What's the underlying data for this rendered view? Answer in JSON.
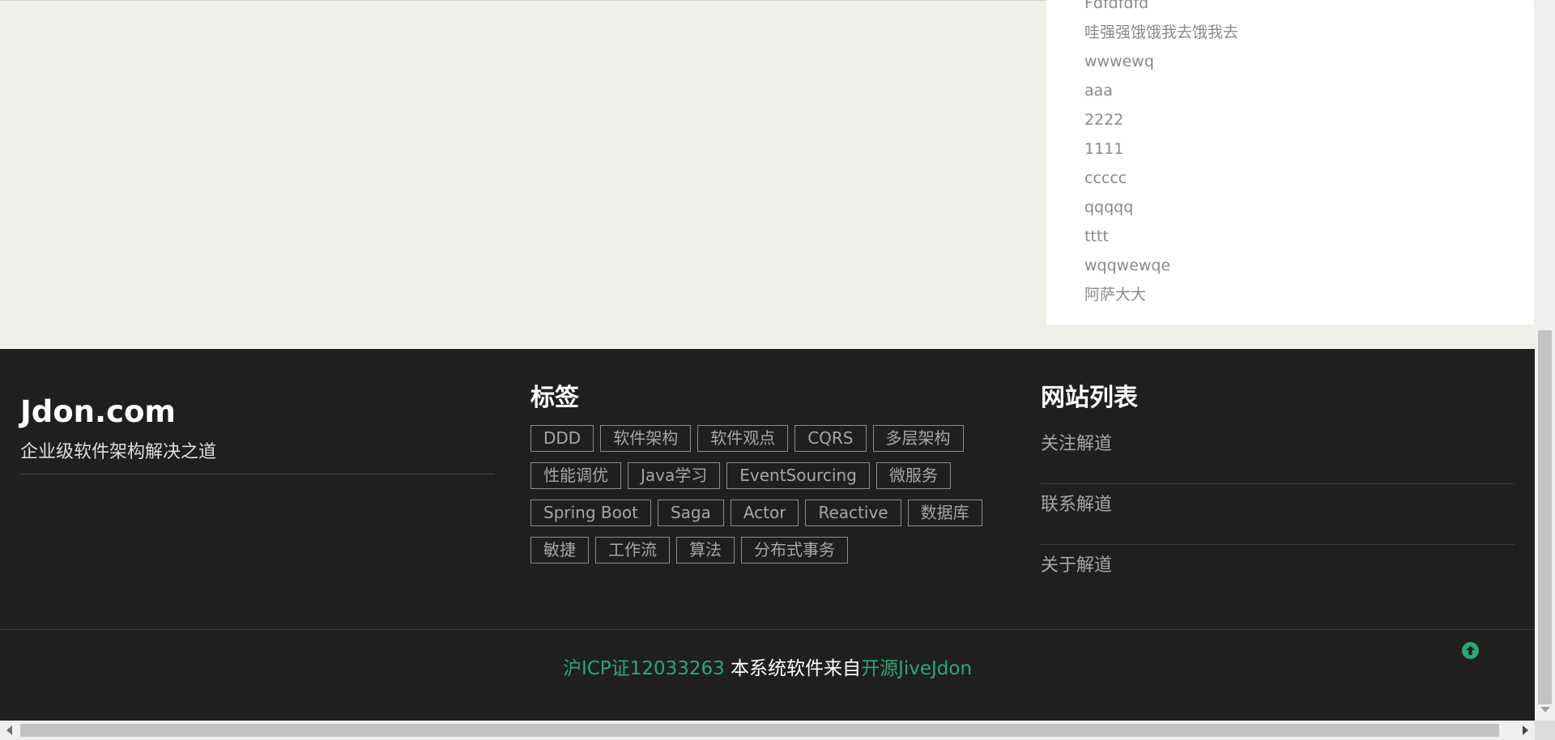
{
  "sidebar": {
    "items": [
      "Fdfdfdfd",
      "哇强强饿饿我去饿我去",
      "wwwewq",
      "aaa",
      "2222",
      "1111",
      "ccccc",
      "qqqqq",
      "tttt",
      "wqqwewqe",
      "阿萨大大"
    ]
  },
  "footer": {
    "brand": {
      "title": "Jdon.com",
      "slogan": "企业级软件架构解决之道"
    },
    "tags": {
      "heading": "标签",
      "items": [
        "DDD",
        "软件架构",
        "软件观点",
        "CQRS",
        "多层架构",
        "性能调优",
        "Java学习",
        "EventSourcing",
        "微服务",
        "Spring Boot",
        "Saga",
        "Actor",
        "Reactive",
        "数据库",
        "敏捷",
        "工作流",
        "算法",
        "分布式事务"
      ]
    },
    "sites": {
      "heading": "网站列表",
      "items": [
        "关注解道",
        "联系解道",
        "关于解道"
      ]
    },
    "copyright": {
      "icp": "沪ICP证12033263",
      "text": " 本系统软件来自",
      "link": "开源JiveJdon"
    },
    "back_to_top_icon": "arrow-up-circle-icon",
    "accent_color": "#2aa876"
  }
}
